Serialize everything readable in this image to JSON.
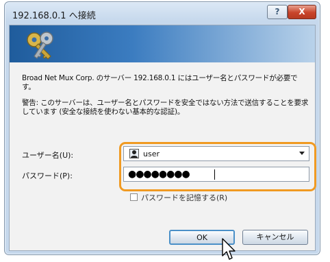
{
  "window": {
    "title": "192.168.0.1 へ接続",
    "help_label": "?",
    "close_label": "X"
  },
  "message": {
    "intro": "Broad Net Mux Corp. のサーバー 192.168.0.1 にはユーザー名とパスワードが必要です。",
    "warning": "警告: このサーバーは、ユーザー名とパスワードを安全ではない方法で送信することを要求しています (安全な接続を使わない基本的な認証)。"
  },
  "form": {
    "username_label": "ユーザー名(U):",
    "username_value": "user",
    "password_label": "パスワード(P):",
    "password_masked": "●●●●●●●●",
    "remember_label": "パスワードを記憶する(R)",
    "remember_checked": false
  },
  "buttons": {
    "ok_label": "OK",
    "cancel_label": "キャンセル"
  },
  "icons": {
    "banner": "keys-icon",
    "user": "user-avatar-icon",
    "dropdown": "chevron-down-icon",
    "pointer": "mouse-cursor-icon"
  },
  "colors": {
    "highlight": "#f09a22",
    "banner_start": "#1f5c9c",
    "banner_end": "#b9d2ea",
    "close_button": "#c8442a"
  }
}
